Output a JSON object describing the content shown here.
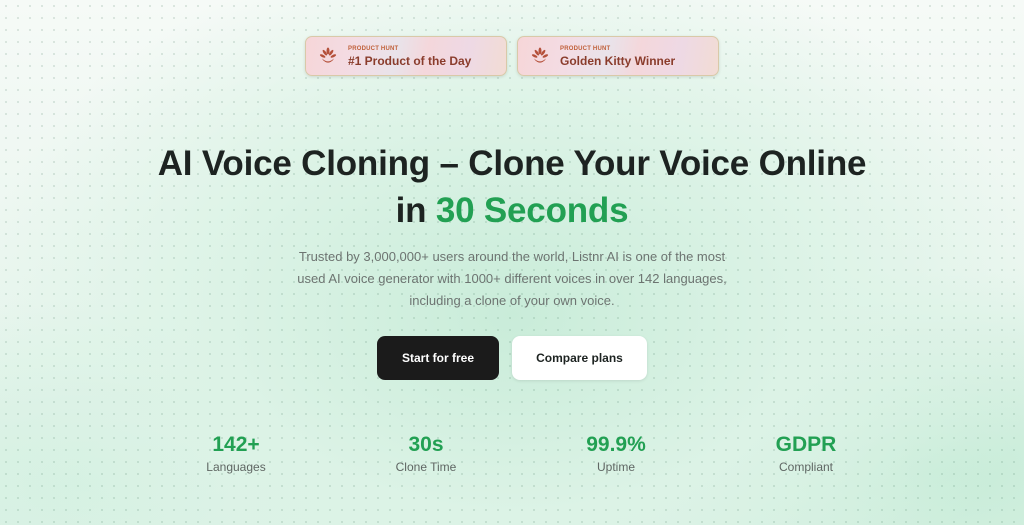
{
  "colors": {
    "accent": "#22a053",
    "text": "#1d2321",
    "primary_button": "#1b1b1b",
    "badge_text": "#8a3c2c"
  },
  "badges": [
    {
      "kicker": "PRODUCT HUNT",
      "title": "#1 Product of the Day",
      "icon": "laurel-icon"
    },
    {
      "kicker": "PRODUCT HUNT",
      "title": "Golden Kitty Winner",
      "icon": "laurel-icon"
    }
  ],
  "hero": {
    "title_line1": "AI Voice Cloning – Clone Your Voice Online",
    "title_line2_prefix": "in ",
    "title_line2_accent": "30 Seconds",
    "description": "Trusted by 3,000,000+ users around the world, Listnr AI is one of the most used AI voice generator with 1000+ different voices in over 142 languages, including a clone of your own voice."
  },
  "buttons": {
    "primary": "Start for free",
    "secondary": "Compare plans"
  },
  "stats": [
    {
      "value": "142+",
      "label": "Languages"
    },
    {
      "value": "30s",
      "label": "Clone Time"
    },
    {
      "value": "99.9%",
      "label": "Uptime"
    },
    {
      "value": "GDPR",
      "label": "Compliant"
    }
  ]
}
